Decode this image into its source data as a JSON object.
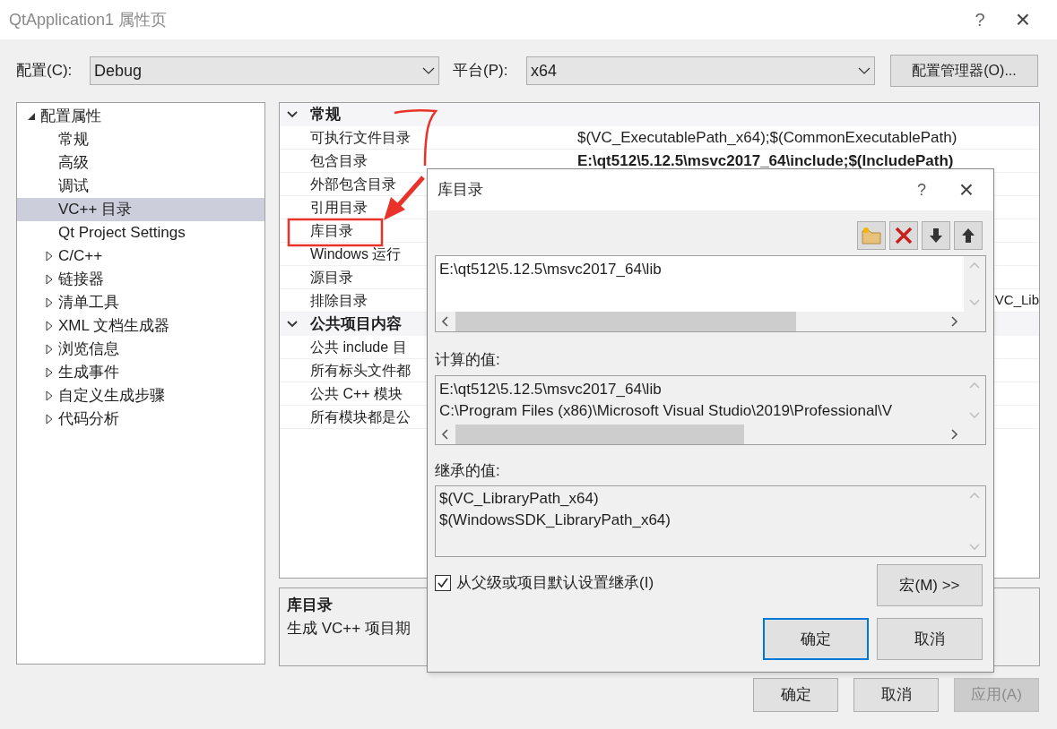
{
  "window": {
    "title": "QtApplication1 属性页",
    "help": "?",
    "close": "×"
  },
  "config": {
    "label": "配置(C):",
    "value": "Debug"
  },
  "platform": {
    "label": "平台(P):",
    "value": "x64"
  },
  "config_manager_button": "配置管理器(O)...",
  "tree": [
    {
      "label": "配置属性",
      "expanded": true,
      "selected": false,
      "children": [
        {
          "label": "常规",
          "selected": false
        },
        {
          "label": "高级",
          "selected": false
        },
        {
          "label": "调试",
          "selected": false
        },
        {
          "label": "VC++ 目录",
          "selected": true
        },
        {
          "label": "Qt Project Settings",
          "selected": false
        },
        {
          "label": "C/C++",
          "expanded": false,
          "selected": false
        },
        {
          "label": "链接器",
          "expanded": false,
          "selected": false
        },
        {
          "label": "清单工具",
          "expanded": false,
          "selected": false
        },
        {
          "label": "XML 文档生成器",
          "expanded": false,
          "selected": false
        },
        {
          "label": "浏览信息",
          "expanded": false,
          "selected": false
        },
        {
          "label": "生成事件",
          "expanded": false,
          "selected": false
        },
        {
          "label": "自定义生成步骤",
          "expanded": false,
          "selected": false
        },
        {
          "label": "代码分析",
          "expanded": false,
          "selected": false
        }
      ]
    }
  ],
  "grid": [
    {
      "title": "常规",
      "expanded": true,
      "rows": [
        {
          "name": "可执行文件目录",
          "value": "$(VC_ExecutablePath_x64);$(CommonExecutablePath)",
          "bold": false
        },
        {
          "name": "包含目录",
          "value": "E:\\qt512\\5.12.5\\msvc2017_64\\include;$(IncludePath)",
          "bold": true
        },
        {
          "name": "外部包含目录"
        },
        {
          "name": "引用目录"
        },
        {
          "name": "库目录"
        },
        {
          "name": "Windows 运行"
        },
        {
          "name": "源目录"
        },
        {
          "name": "排除目录",
          "value": "VC_Lib",
          "bold": false
        }
      ]
    },
    {
      "title": "公共项目内容",
      "expanded": true,
      "rows": [
        {
          "name": "公共 include 目"
        },
        {
          "name": "所有标头文件都"
        },
        {
          "name": "公共 C++ 模块"
        },
        {
          "name": "所有模块都是公"
        }
      ]
    }
  ],
  "description": {
    "title": "库目录",
    "text": "生成 VC++ 项目期"
  },
  "buttons": [
    {
      "label": "确定",
      "disabled": false
    },
    {
      "label": "取消",
      "disabled": false
    },
    {
      "label": "应用(A)",
      "disabled": true
    }
  ],
  "dialog": {
    "title": "库目录",
    "help": "?",
    "close": "×",
    "entries": [
      "E:\\qt512\\5.12.5\\msvc2017_64\\lib"
    ],
    "computed_label": "计算的值:",
    "computed": [
      "E:\\qt512\\5.12.5\\msvc2017_64\\lib",
      "C:\\Program Files (x86)\\Microsoft Visual Studio\\2019\\Professional\\V"
    ],
    "inherited_label": "继承的值:",
    "inherited": [
      "$(VC_LibraryPath_x64)",
      "$(WindowsSDK_LibraryPath_x64)"
    ],
    "inherit_checkbox": {
      "label": "从父级或项目默认设置继承(I)",
      "checked": true
    },
    "macro_button": "宏(M) >>",
    "ok_button": "确定",
    "cancel_button": "取消"
  }
}
